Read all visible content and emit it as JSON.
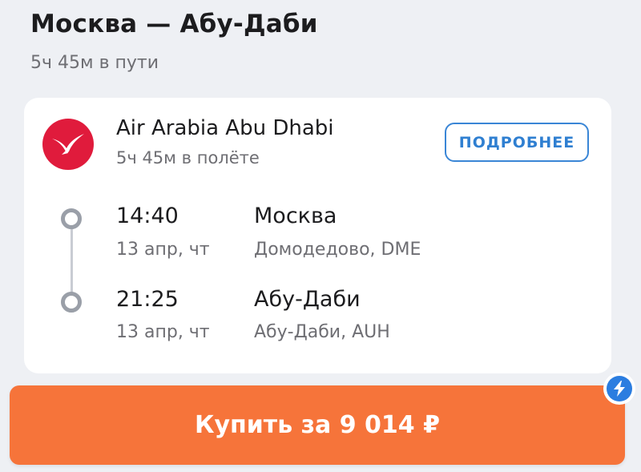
{
  "header": {
    "route": "Москва — Абу-Даби",
    "duration": "5ч 45м в пути"
  },
  "flight": {
    "airline": "Air Arabia Abu Dhabi",
    "logo_icon": "gull-icon",
    "logo_color": "#e01b3c",
    "flight_duration": "5ч 45м в полёте",
    "details_label": "ПОДРОБНЕЕ",
    "departure": {
      "time": "14:40",
      "date": "13 апр, чт",
      "city": "Москва",
      "airport": "Домодедово, DME"
    },
    "arrival": {
      "time": "21:25",
      "date": "13 апр, чт",
      "city": "Абу-Даби",
      "airport": "Абу-Даби, AUH"
    }
  },
  "purchase": {
    "label": "Купить за 9 014 ₽",
    "button_color": "#f6743a",
    "badge_icon": "lightning-icon",
    "badge_color": "#2b7de0"
  }
}
